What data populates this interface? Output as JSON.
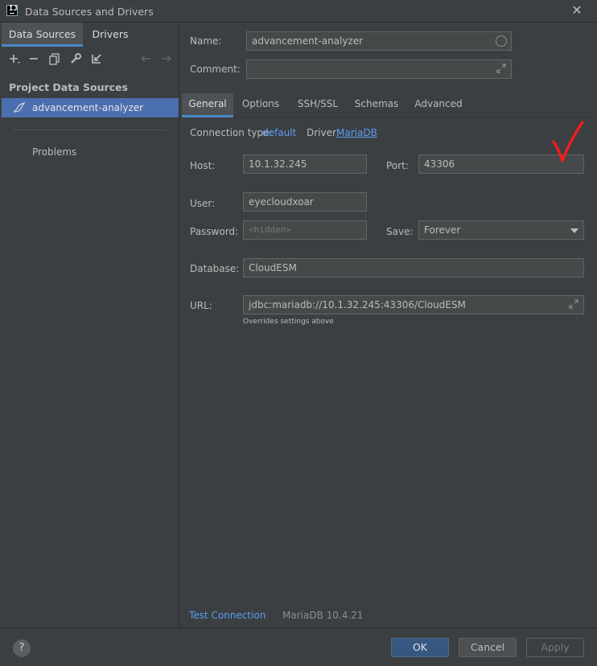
{
  "window": {
    "title": "Data Sources and Drivers"
  },
  "left": {
    "tabs": [
      "Data Sources",
      "Drivers"
    ],
    "section_title": "Project Data Sources",
    "data_source": "advancement-analyzer",
    "problems": "Problems"
  },
  "form": {
    "name_label": "Name:",
    "name_value": "advancement-analyzer",
    "comment_label": "Comment:",
    "comment_value": "",
    "tabs": [
      "General",
      "Options",
      "SSH/SSL",
      "Schemas",
      "Advanced"
    ],
    "connection_type_label": "Connection type:",
    "connection_type_value": "default",
    "driver_label": "Driver:",
    "driver_value": "MariaDB",
    "host_label": "Host:",
    "host_value": "10.1.32.245",
    "port_label": "Port:",
    "port_value": "43306",
    "user_label": "User:",
    "user_value": "eyecloudxoar",
    "password_label": "Password:",
    "password_placeholder": "<hidden>",
    "save_label": "Save:",
    "save_value": "Forever",
    "database_label": "Database:",
    "database_value": "CloudESM",
    "url_label": "URL:",
    "url_value": "jdbc:mariadb://10.1.32.245:43306/CloudESM",
    "url_note": "Overrides settings above"
  },
  "status": {
    "test_connection": "Test Connection",
    "db_version": "MariaDB 10.4.21"
  },
  "footer": {
    "help": "?",
    "ok": "OK",
    "cancel": "Cancel",
    "apply": "Apply"
  },
  "colors": {
    "accent": "#4a88c7",
    "link": "#589df6",
    "selection": "#4b6eaf",
    "annotation": "#ff0000"
  }
}
